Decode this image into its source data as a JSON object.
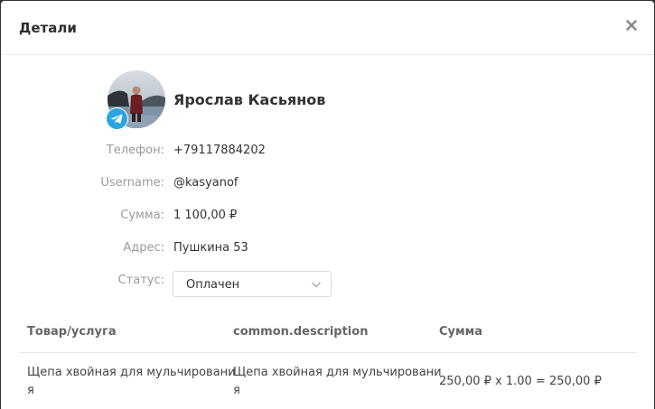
{
  "modal": {
    "title": "Детали"
  },
  "user": {
    "name": "Ярослав Касьянов"
  },
  "fields": {
    "phone_label": "Телефон:",
    "phone_value": "+79117884202",
    "username_label": "Username:",
    "username_value": "@kasyanof",
    "sum_label": "Сумма:",
    "sum_value": "1 100,00 ₽",
    "address_label": "Адрес:",
    "address_value": "Пушкина 53",
    "status_label": "Статус:",
    "status_value": "Оплачен"
  },
  "table": {
    "headers": [
      "Товар/услуга",
      "common.description",
      "Сумма"
    ],
    "rows": [
      {
        "product_line1": "Щепа хвойная для мульчировани",
        "product_line2": "я",
        "description_line1": "Щепа хвойная для мульчировани",
        "description_line2": "я",
        "sum": "250,00 ₽ x 1.00 = 250,00 ₽"
      }
    ]
  },
  "colors": {
    "telegram": "#2ca5e0",
    "label": "#9a9a9a",
    "text": "#333333"
  }
}
